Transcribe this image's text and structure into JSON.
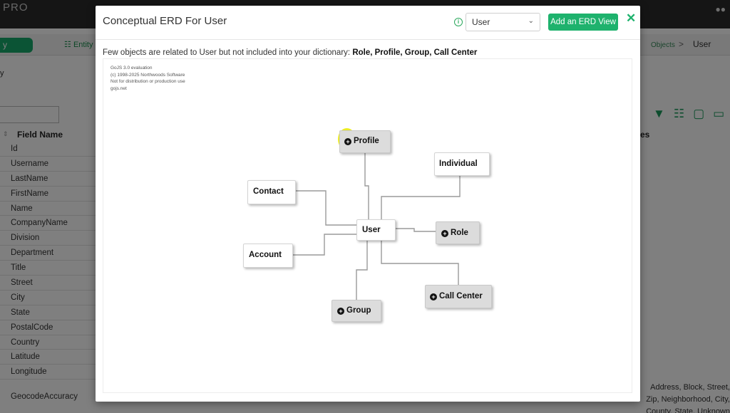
{
  "background": {
    "brand": "PRO",
    "green_pill": "y",
    "entity_tab": "Entity",
    "breadcrumb": {
      "objects": "Objects",
      "separator": ">",
      "current": "User"
    },
    "side_label": "y",
    "column_field_name": "Field Name",
    "column_right_partial": "es",
    "fields": [
      "Id",
      "Username",
      "LastName",
      "FirstName",
      "Name",
      "CompanyName",
      "Division",
      "Department",
      "Title",
      "Street",
      "City",
      "State",
      "PostalCode",
      "Country",
      "Latitude",
      "Longitude"
    ],
    "field_last": "GeocodeAccuracy",
    "right_text_lines": [
      "Address, Block, Street,",
      "Zip, Neighborhood, City,",
      "County, State, Unknown"
    ]
  },
  "modal": {
    "title": "Conceptual ERD For User",
    "select_value": "User",
    "add_button": "Add an ERD View",
    "close_symbol": "✕",
    "note_prefix": "Few objects are related to User but not included into your dictionary:",
    "note_missing": "Role, Profile, Group, Call Center"
  },
  "diagram": {
    "watermark": [
      "GoJS 3.0 evaluation",
      "(c) 1998-2025 Northwoods Software",
      "Not for distribution or production use",
      "gojs.net"
    ],
    "nodes": {
      "user": "User",
      "profile": "Profile",
      "individual": "Individual",
      "contact": "Contact",
      "role": "Role",
      "account": "Account",
      "group": "Group",
      "call_center": "Call Center"
    },
    "not_in_dictionary": [
      "Profile",
      "Role",
      "Group",
      "Call Center"
    ]
  }
}
